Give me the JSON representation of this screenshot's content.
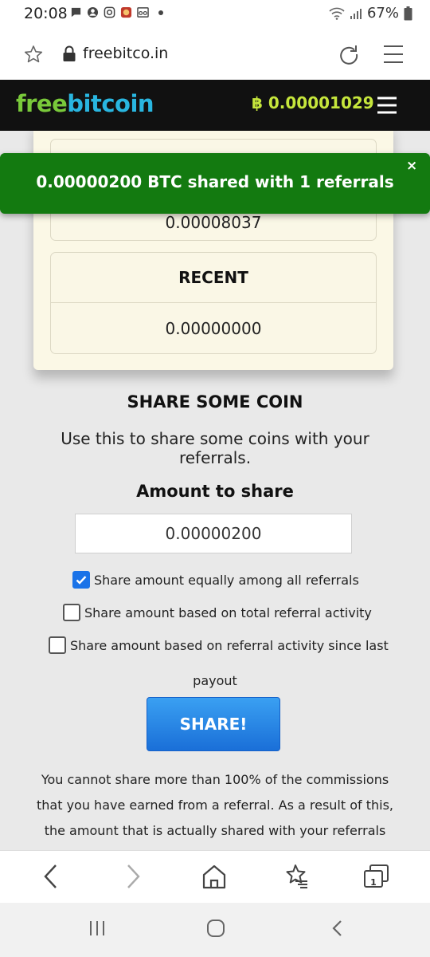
{
  "status_bar": {
    "time": "20:08",
    "battery": "67%",
    "left_icons": [
      "chat-icon",
      "account-icon",
      "instagram-icon",
      "app-icon",
      "voicemail-icon"
    ]
  },
  "browser": {
    "url": "freebitco.in",
    "tab_count": "1"
  },
  "site": {
    "logo_part1": "free",
    "logo_part2": "bitcoin",
    "balance": "฿ 0.00001029",
    "colors": {
      "logo_green": "#79c93a",
      "logo_blue": "#29b6e0",
      "balance_yellow": "#c6e63c",
      "header_bg": "#111111"
    }
  },
  "stats": {
    "box1_value": "0.00008037",
    "recent_label": "RECENT",
    "recent_value": "0.00000000"
  },
  "share": {
    "title": "SHARE SOME COIN",
    "description": "Use this to share some coins with your referrals.",
    "amount_label": "Amount to share",
    "amount_value": "0.00000200",
    "options": [
      {
        "label": "Share amount equally among all referrals",
        "checked": true
      },
      {
        "label": "Share amount based on total referral activity",
        "checked": false
      },
      {
        "label": "Share amount based on referral activity since last",
        "checked": false
      }
    ],
    "option3_continued": "payout",
    "button_label": "SHARE!",
    "notice": "You cannot share more than 100% of the commissions that you have earned from a referral. As a result of this, the amount that is actually shared with your referrals"
  },
  "toast": {
    "message": "0.00000200 BTC shared with 1 referrals",
    "close": "×",
    "color": "#137a10"
  }
}
